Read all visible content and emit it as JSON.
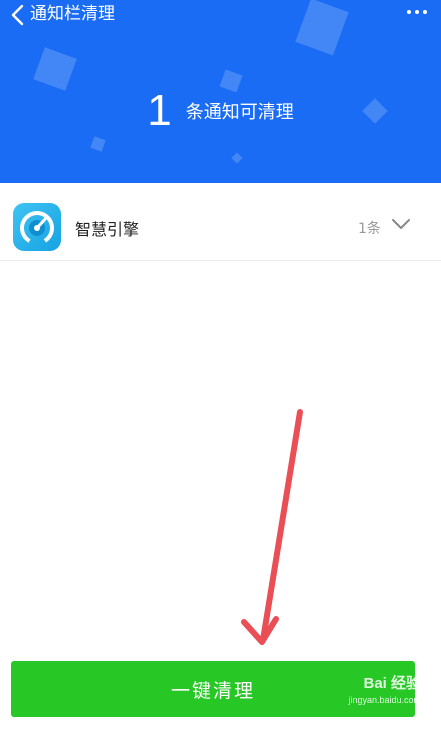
{
  "colors": {
    "header_bg": "#1a6cf5",
    "accent_green": "#27c825",
    "arrow_red": "#e94f55"
  },
  "nav": {
    "title": "通知栏清理",
    "back_icon": "chevron-left-icon",
    "more_icon": "more-dots-icon"
  },
  "summary": {
    "count": "1",
    "label": "条通知可清理"
  },
  "notifications": [
    {
      "app_name": "智慧引擎",
      "count_label": "1条",
      "icon": "speedometer-app-icon"
    }
  ],
  "primary_action": {
    "label": "一键清理"
  },
  "watermark": {
    "brand": "Bai  经验",
    "url": "jingyan.baidu.com"
  }
}
